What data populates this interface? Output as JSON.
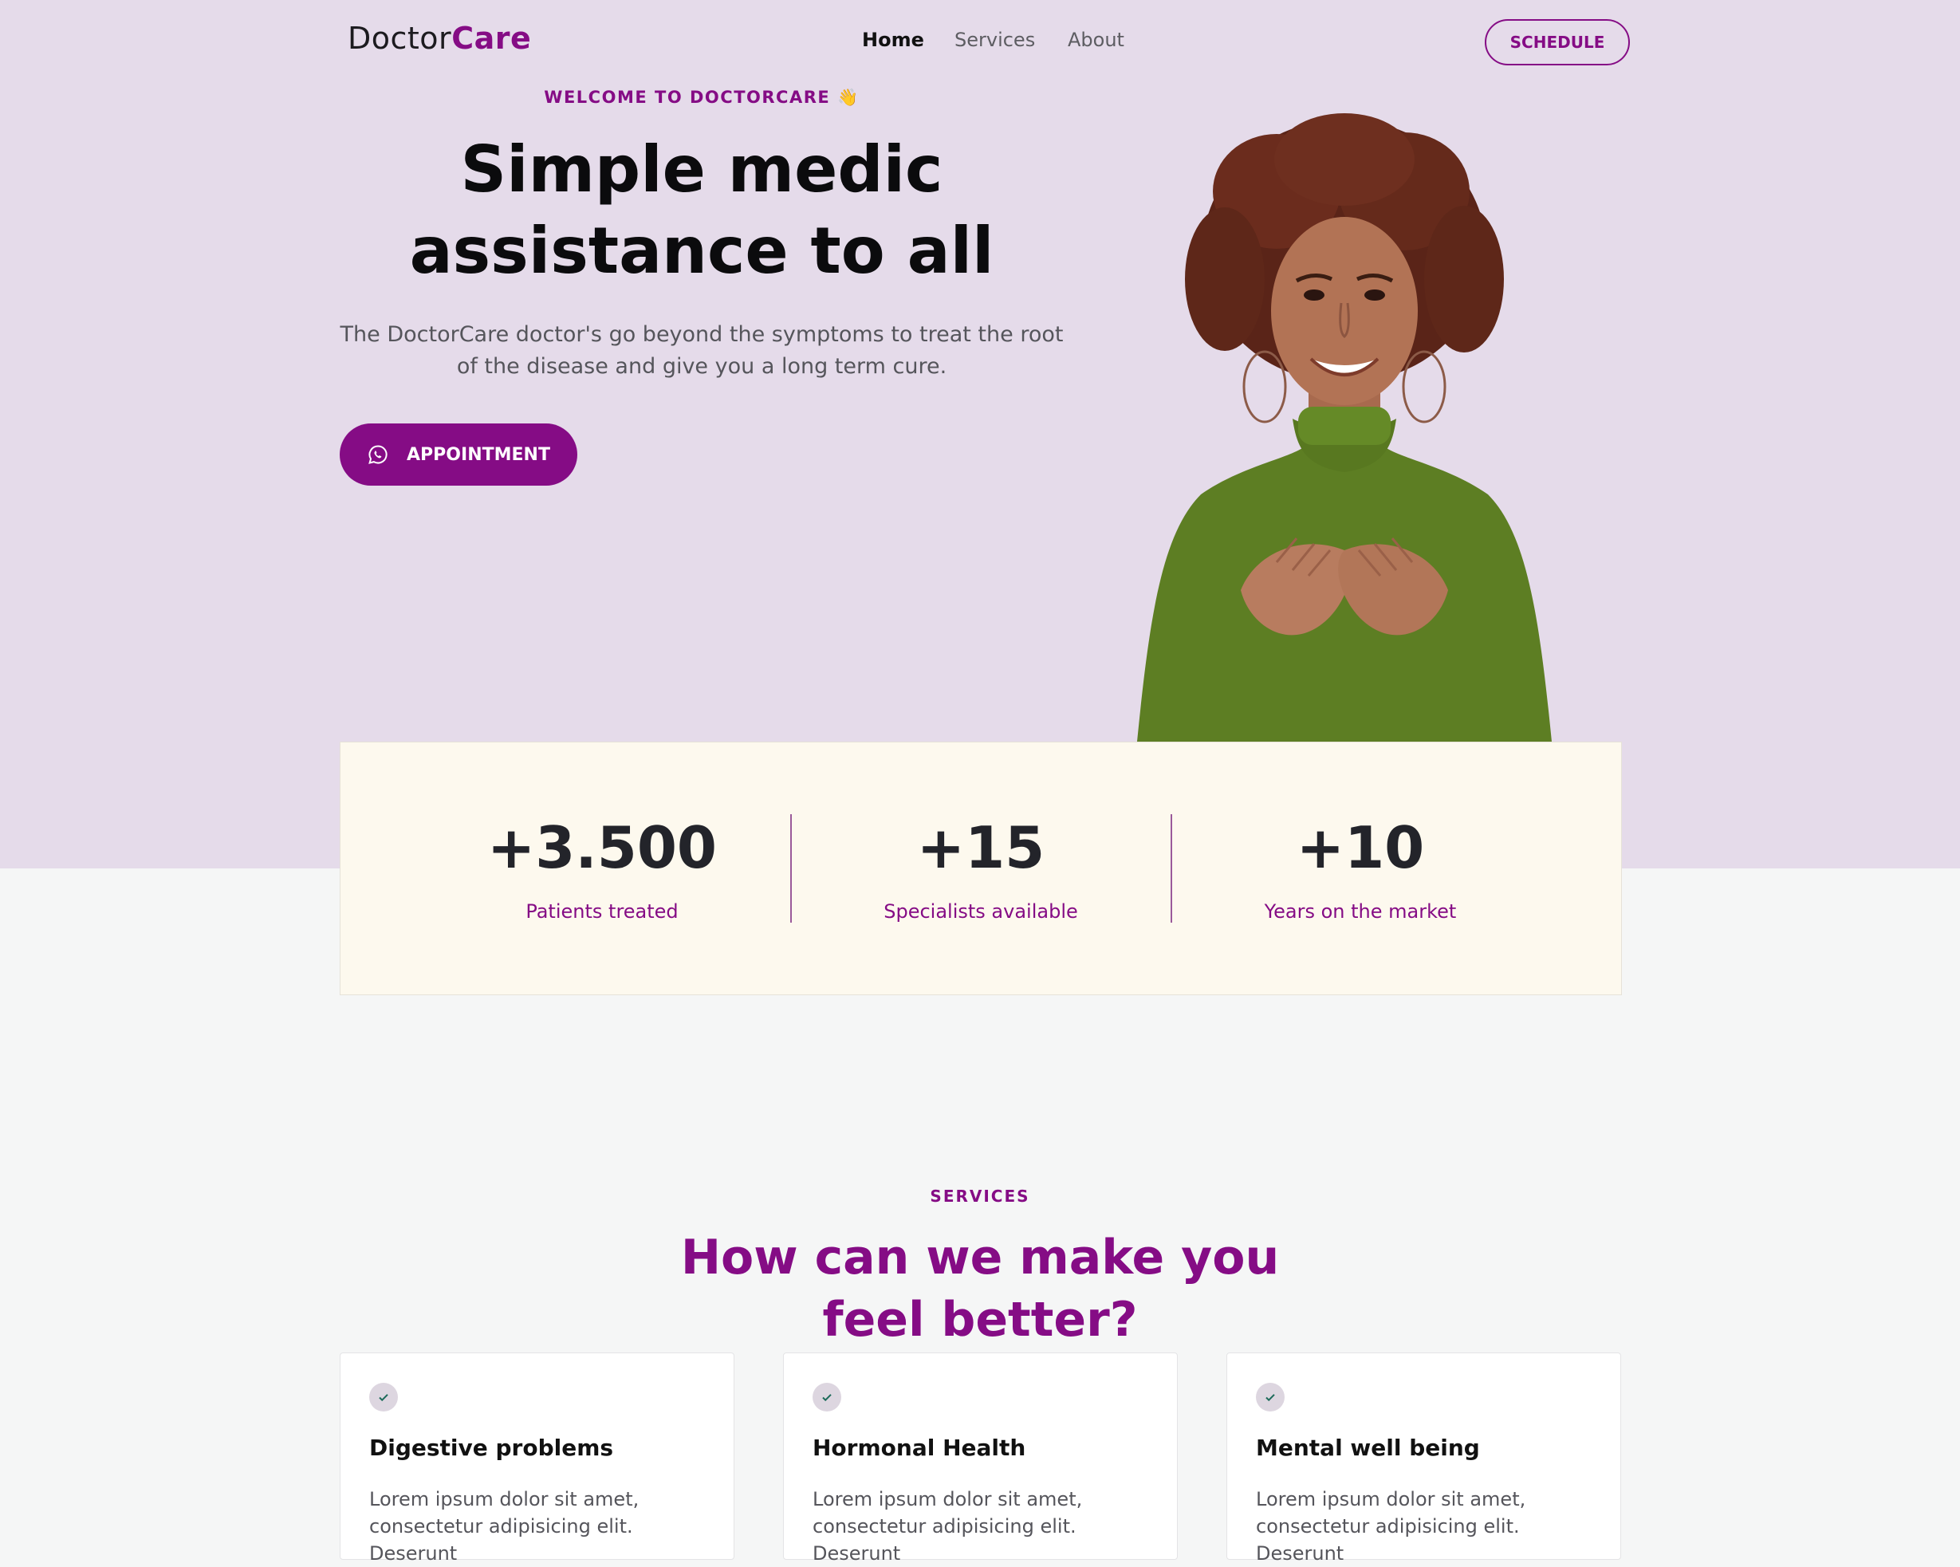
{
  "colors": {
    "accent": "#850c85",
    "hero_bg": "#e5dbea",
    "stats_bg": "#fdf9ee",
    "page_bg": "#f5f6f6"
  },
  "header": {
    "logo_primary": "Doctor",
    "logo_accent": "Care",
    "nav": [
      {
        "label": "Home",
        "active": true
      },
      {
        "label": "Services",
        "active": false
      },
      {
        "label": "About",
        "active": false
      }
    ],
    "schedule_label": "SCHEDULE"
  },
  "hero": {
    "kicker": "WELCOME TO DOCTORCARE 👋",
    "headline": "Simple medic assistance to all",
    "subtext": "The DoctorCare doctor's go beyond the symptoms to treat the root of the disease and give you a long term cure.",
    "appointment_label": "APPOINTMENT",
    "appointment_icon": "whatsapp-icon",
    "image": "smiling-woman-portrait"
  },
  "stats": [
    {
      "number": "+3.500",
      "label": "Patients treated"
    },
    {
      "number": "+15",
      "label": "Specialists available"
    },
    {
      "number": "+10",
      "label": "Years on the market"
    }
  ],
  "services": {
    "kicker": "SERVICES",
    "title": "How can we make you feel better?",
    "cards": [
      {
        "title": "Digestive problems",
        "body": "Lorem ipsum dolor sit amet, consectetur adipisicing elit. Deserunt"
      },
      {
        "title": "Hormonal Health",
        "body": "Lorem ipsum dolor sit amet, consectetur adipisicing elit. Deserunt"
      },
      {
        "title": "Mental well being",
        "body": "Lorem ipsum dolor sit amet, consectetur adipisicing elit. Deserunt"
      }
    ],
    "card_icon": "check-icon"
  }
}
